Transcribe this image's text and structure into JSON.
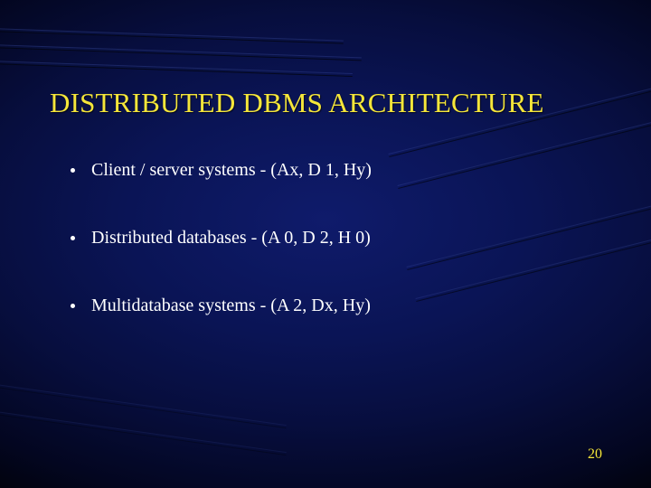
{
  "slide": {
    "title": "DISTRIBUTED DBMS ARCHITECTURE",
    "bullets": [
      "Client / server systems - (Ax, D 1, Hy)",
      "Distributed databases - (A 0, D 2, H 0)",
      "Multidatabase systems - (A 2, Dx, Hy)"
    ],
    "page_number": "20"
  }
}
